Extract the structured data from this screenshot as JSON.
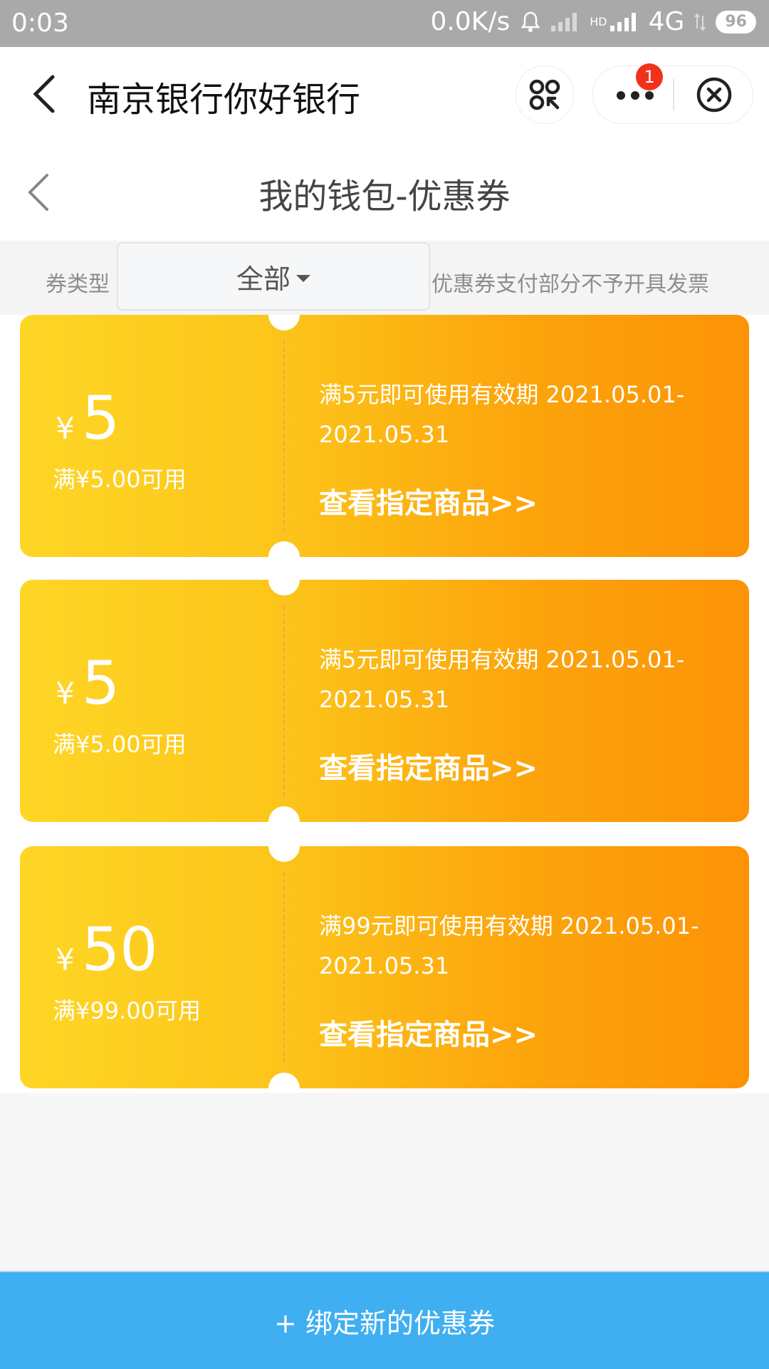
{
  "status_bar": {
    "time": "0:03",
    "speed": "0.0K/s",
    "hd": "HD",
    "network": "4G",
    "battery": "96"
  },
  "mini_header": {
    "title": "南京银行你好银行",
    "badge": "1"
  },
  "page_header": {
    "title": "我的钱包-优惠券"
  },
  "filter": {
    "label": "券类型",
    "selected": "全部",
    "note": "优惠券支付部分不予开具发票"
  },
  "coupons": [
    {
      "currency": "¥",
      "amount": "5",
      "condition": "满¥5.00可用",
      "description": "满5元即可使用有效期 2021.05.01-2021.05.31",
      "link": "查看指定商品>>"
    },
    {
      "currency": "¥",
      "amount": "5",
      "condition": "满¥5.00可用",
      "description": "满5元即可使用有效期 2021.05.01-2021.05.31",
      "link": "查看指定商品>>"
    },
    {
      "currency": "¥",
      "amount": "50",
      "condition": "满¥99.00可用",
      "description": "满99元即可使用有效期 2021.05.01-2021.05.31",
      "link": "查看指定商品>>"
    }
  ],
  "bottom_button": {
    "label": "+ 绑定新的优惠券"
  },
  "colors": {
    "accent": "#40aff1",
    "coupon_start": "#fed626",
    "coupon_end": "#fc9306",
    "badge": "#f2311b"
  }
}
